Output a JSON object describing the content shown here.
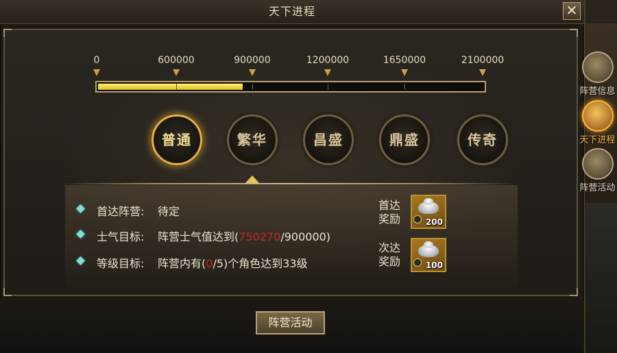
{
  "window": {
    "title": "天下进程",
    "close_label": "✕"
  },
  "progress": {
    "ticks": [
      "0",
      "600000",
      "900000",
      "1200000",
      "1650000",
      "2100000"
    ],
    "current_fraction": 0.375
  },
  "tiers": [
    {
      "name": "普通",
      "active": true
    },
    {
      "name": "繁华",
      "active": false
    },
    {
      "name": "昌盛",
      "active": false
    },
    {
      "name": "鼎盛",
      "active": false
    },
    {
      "name": "传奇",
      "active": false
    }
  ],
  "objectives": [
    {
      "label": "首达阵营:",
      "value_parts": [
        "待定"
      ]
    },
    {
      "label": "士气目标:",
      "value_prefix": "阵营士气值达到(",
      "value_current": "750270",
      "value_suffix": "/900000)"
    },
    {
      "label": "等级目标:",
      "value_prefix": "阵营内有(",
      "value_current": "0",
      "value_suffix": "/5)个角色达到33级"
    }
  ],
  "rewards": [
    {
      "label": "首达奖励",
      "item": "silver-ingot",
      "quantity": "200"
    },
    {
      "label": "次达奖励",
      "item": "silver-ingot",
      "quantity": "100"
    }
  ],
  "buttons": {
    "camp_activity": "阵营活动"
  },
  "side_tabs": [
    {
      "label": "阵营信息",
      "icon": "fan-icon",
      "active": false
    },
    {
      "label": "天下进程",
      "icon": "scroll-icon",
      "active": true
    },
    {
      "label": "阵营活动",
      "icon": "ship-icon",
      "active": false
    }
  ],
  "colors": {
    "highlight_red": "#c22a1e",
    "progress_fill": "#f0d631",
    "active_tab": "#ffb84a"
  }
}
